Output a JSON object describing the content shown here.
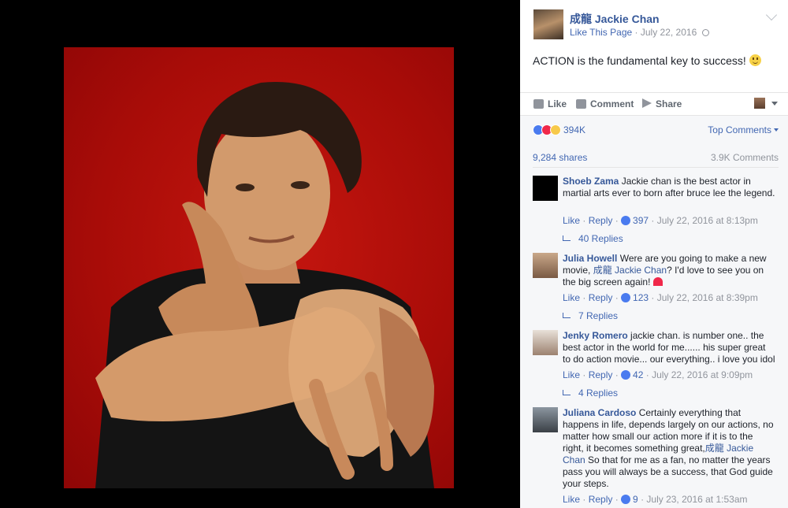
{
  "post": {
    "page_name": "成龍 Jackie Chan",
    "like_page": "Like This Page",
    "date": "July 22, 2016",
    "separator": "·",
    "text": "ACTION is the fundamental key to success!",
    "icons": {
      "privacy": "globe-icon",
      "menu": "chevron-down-icon",
      "emoji": "smiley-icon"
    }
  },
  "actions": {
    "like": "Like",
    "comment": "Comment",
    "share": "Share"
  },
  "stats": {
    "reactions_count": "394K",
    "top_comments": "Top Comments",
    "shares": "9,284 shares",
    "comments": "3.9K Comments"
  },
  "comments": [
    {
      "name": "Shoeb Zama",
      "text": "Jackie chan is the best actor in martial arts ever to born after bruce lee the legend.",
      "like": "Like",
      "reply": "Reply",
      "likes": "397",
      "time": "July 22, 2016 at 8:13pm",
      "replies": "40 Replies"
    },
    {
      "name": "Julia Howell",
      "text_before": "Were are you going to make a new movie,",
      "mention": "成龍 Jackie Chan",
      "text_after": "? I'd love to see you on the big screen again!",
      "like": "Like",
      "reply": "Reply",
      "likes": "123",
      "time": "July 22, 2016 at 8:39pm",
      "replies": "7 Replies"
    },
    {
      "name": "Jenky Romero",
      "text": "jackie chan. is number one.. the best actor in the world for me...... his super great to do action movie... our everything.. i love you idol",
      "like": "Like",
      "reply": "Reply",
      "likes": "42",
      "time": "July 22, 2016 at 9:09pm",
      "replies": "4 Replies"
    },
    {
      "name": "Juliana Cardoso",
      "text_before": "Certainly everything that happens in life, depends largely on our actions, no matter how small our action more if it is to the right, it becomes something great,",
      "mention": "成龍 Jackie Chan",
      "text_after": "So that for me as a fan, no matter the years pass you will always be a success, that God guide your steps.",
      "like": "Like",
      "reply": "Reply",
      "likes": "9",
      "time": "July 23, 2016 at 1:53am"
    }
  ],
  "colors": {
    "link": "#365899",
    "accent": "#4267b2",
    "photo_background": "#b30d09"
  }
}
